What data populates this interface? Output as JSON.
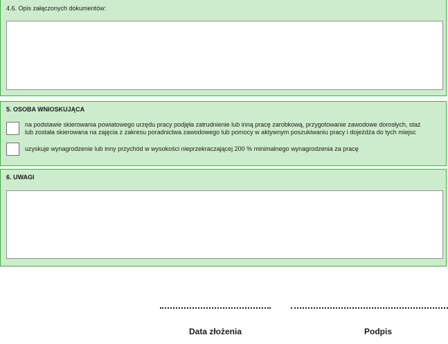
{
  "section_4_6": {
    "label": "4.6. Opis załączonych dokumentów:",
    "textarea_value": ""
  },
  "section_5": {
    "heading": "5. OSOBA WNIOSKUJĄCA",
    "options": [
      {
        "checked": false,
        "line1": "na podstawie skierowania powiatowego urzędu pracy podjęła zatrudnienie lub inną pracę zarobkową, przygotowanie zawodowe dorosłych, staż",
        "line2": "lub została skierowana na zajęcia z zakresu poradnictwa zawodowego lub pomocy w aktywnym poszukiwaniu pracy i dojeżdża do tych miejsc"
      },
      {
        "checked": false,
        "line1": "uzyskuje wynagrodzenie lub inny przychód w wysokości nieprzekraczającej 200 % minimalnego wynagrodzenia za pracę"
      }
    ]
  },
  "section_6": {
    "heading": "6. UWAGI",
    "textarea_value": ""
  },
  "signature": {
    "date_label": "Data złożenia",
    "sign_label": "Podpis"
  },
  "colors": {
    "section_bg": "#cdeccd",
    "section_border": "#3faa3f"
  }
}
